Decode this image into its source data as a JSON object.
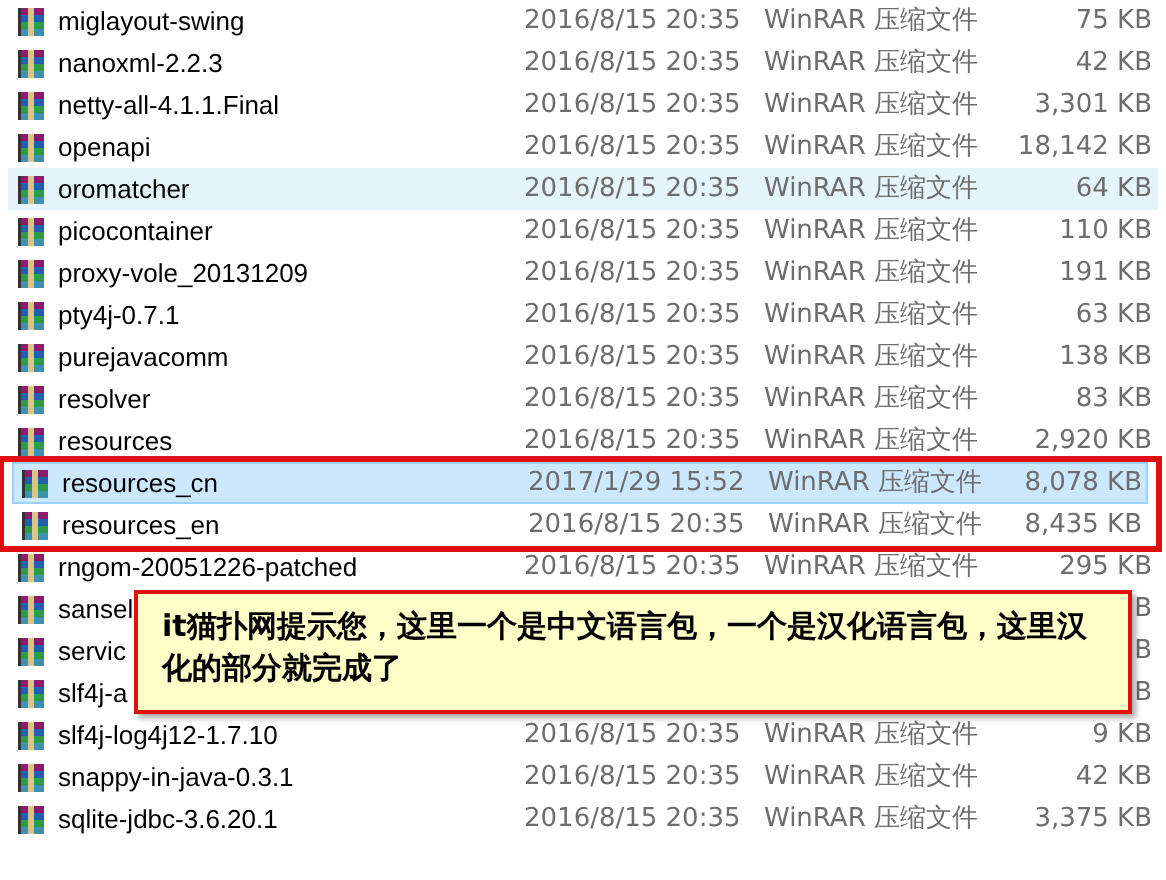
{
  "files": [
    {
      "name": "miglayout-swing",
      "date": "2016/8/15 20:35",
      "type": "WinRAR 压缩文件",
      "size": "75 KB",
      "selected": false,
      "hovered": false,
      "highlighted": false
    },
    {
      "name": "nanoxml-2.2.3",
      "date": "2016/8/15 20:35",
      "type": "WinRAR 压缩文件",
      "size": "42 KB",
      "selected": false,
      "hovered": false,
      "highlighted": false
    },
    {
      "name": "netty-all-4.1.1.Final",
      "date": "2016/8/15 20:35",
      "type": "WinRAR 压缩文件",
      "size": "3,301 KB",
      "selected": false,
      "hovered": false,
      "highlighted": false
    },
    {
      "name": "openapi",
      "date": "2016/8/15 20:35",
      "type": "WinRAR 压缩文件",
      "size": "18,142 KB",
      "selected": false,
      "hovered": false,
      "highlighted": false
    },
    {
      "name": "oromatcher",
      "date": "2016/8/15 20:35",
      "type": "WinRAR 压缩文件",
      "size": "64 KB",
      "selected": false,
      "hovered": true,
      "highlighted": false
    },
    {
      "name": "picocontainer",
      "date": "2016/8/15 20:35",
      "type": "WinRAR 压缩文件",
      "size": "110 KB",
      "selected": false,
      "hovered": false,
      "highlighted": false
    },
    {
      "name": "proxy-vole_20131209",
      "date": "2016/8/15 20:35",
      "type": "WinRAR 压缩文件",
      "size": "191 KB",
      "selected": false,
      "hovered": false,
      "highlighted": false
    },
    {
      "name": "pty4j-0.7.1",
      "date": "2016/8/15 20:35",
      "type": "WinRAR 压缩文件",
      "size": "63 KB",
      "selected": false,
      "hovered": false,
      "highlighted": false
    },
    {
      "name": "purejavacomm",
      "date": "2016/8/15 20:35",
      "type": "WinRAR 压缩文件",
      "size": "138 KB",
      "selected": false,
      "hovered": false,
      "highlighted": false
    },
    {
      "name": "resolver",
      "date": "2016/8/15 20:35",
      "type": "WinRAR 压缩文件",
      "size": "83 KB",
      "selected": false,
      "hovered": false,
      "highlighted": false
    },
    {
      "name": "resources",
      "date": "2016/8/15 20:35",
      "type": "WinRAR 压缩文件",
      "size": "2,920 KB",
      "selected": false,
      "hovered": false,
      "highlighted": false
    },
    {
      "name": "resources_cn",
      "date": "2017/1/29 15:52",
      "type": "WinRAR 压缩文件",
      "size": "8,078 KB",
      "selected": true,
      "hovered": false,
      "highlighted": true
    },
    {
      "name": "resources_en",
      "date": "2016/8/15 20:35",
      "type": "WinRAR 压缩文件",
      "size": "8,435 KB",
      "selected": false,
      "hovered": false,
      "highlighted": true
    },
    {
      "name": "rngom-20051226-patched",
      "date": "2016/8/15 20:35",
      "type": "WinRAR 压缩文件",
      "size": "295 KB",
      "selected": false,
      "hovered": false,
      "highlighted": false
    },
    {
      "name": "sansel",
      "size": "B",
      "selected": false,
      "hovered": false,
      "highlighted": false
    },
    {
      "name": "servic",
      "size": "B",
      "selected": false,
      "hovered": false,
      "highlighted": false
    },
    {
      "name": "slf4j-a",
      "size": "B",
      "selected": false,
      "hovered": false,
      "highlighted": false
    },
    {
      "name": "slf4j-log4j12-1.7.10",
      "date": "2016/8/15 20:35",
      "type": "WinRAR 压缩文件",
      "size": "9 KB",
      "selected": false,
      "hovered": false,
      "highlighted": false
    },
    {
      "name": "snappy-in-java-0.3.1",
      "date": "2016/8/15 20:35",
      "type": "WinRAR 压缩文件",
      "size": "42 KB",
      "selected": false,
      "hovered": false,
      "highlighted": false
    },
    {
      "name": "sqlite-jdbc-3.6.20.1",
      "date": "2016/8/15 20:35",
      "type": "WinRAR 压缩文件",
      "size": "3,375 KB",
      "selected": false,
      "hovered": false,
      "highlighted": false
    }
  ],
  "callout": {
    "text": "it猫扑网提示您，这里一个是中文语言包，一个是汉化语言包，这里汉化的部分就完成了"
  }
}
